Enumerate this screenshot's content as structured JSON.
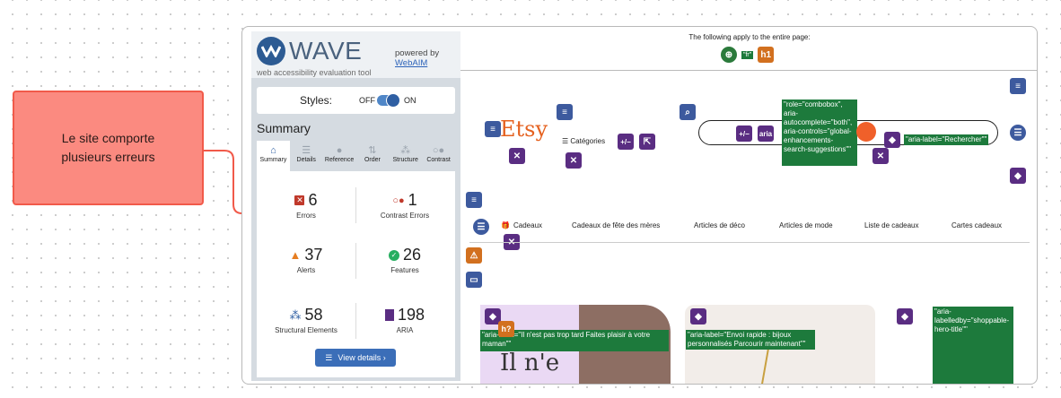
{
  "callout": {
    "text": "Le site comporte plusieurs erreurs"
  },
  "wave": {
    "brand": "WAVE",
    "tagline": "web accessibility evaluation tool",
    "powered_by": "powered by",
    "webaim": "WebAIM",
    "styles_label": "Styles:",
    "styles_off": "OFF",
    "styles_on": "ON",
    "summary_title": "Summary",
    "tabs": [
      {
        "label": "Summary",
        "icon": "home-icon"
      },
      {
        "label": "Details",
        "icon": "list-icon"
      },
      {
        "label": "Reference",
        "icon": "info-icon"
      },
      {
        "label": "Order",
        "icon": "order-icon"
      },
      {
        "label": "Structure",
        "icon": "structure-icon"
      },
      {
        "label": "Contrast",
        "icon": "contrast-icon"
      }
    ],
    "stats": {
      "errors": {
        "value": "6",
        "label": "Errors"
      },
      "contrast": {
        "value": "1",
        "label": "Contrast Errors"
      },
      "alerts": {
        "value": "37",
        "label": "Alerts"
      },
      "features": {
        "value": "26",
        "label": "Features"
      },
      "structural": {
        "value": "58",
        "label": "Structural Elements"
      },
      "aria": {
        "value": "198",
        "label": "ARIA"
      }
    },
    "view_details": "View details ›"
  },
  "site": {
    "apply_text": "The following apply to the entire page:",
    "lang_badge": "\"fr\"",
    "h1_badge": "h1",
    "etsy": "Etsy",
    "categories": "Catégories",
    "aria_badge": "aria",
    "plusminus": "+/−",
    "combobox_text": "\"role=\"combobox\", aria-autocomplete=\"both\", aria-controls=\"global-enhancements-search-suggestions\"\"",
    "search_label_text": "\"aria-label=\"Rechercher\"\"",
    "nav": [
      "Cadeaux",
      "Cadeaux de fête des mères",
      "Articles de déco",
      "Articles de mode",
      "Liste de cadeaux",
      "Cartes cadeaux"
    ],
    "card1_label": "\"aria-label=\"Il n'est pas trop tard Faites plaisir à votre maman\"\"",
    "card1_prefix": "\"aria",
    "h2_badge": "h?",
    "card1_big": "Il n'e",
    "card2_label": "\"aria-label=\"Envoi rapide : bijoux personnalisés Parcourir maintenant\"\"",
    "card3_label": "\"aria-labelledby=\"shoppable-hero-title\"\""
  },
  "colors": {
    "wave_blue": "#2f5fa3",
    "error_red": "#c0392b",
    "alert_orange": "#e67e22",
    "feature_green": "#27ae60",
    "aria_purple": "#5a2d82",
    "callout_red": "#fb8a80"
  }
}
